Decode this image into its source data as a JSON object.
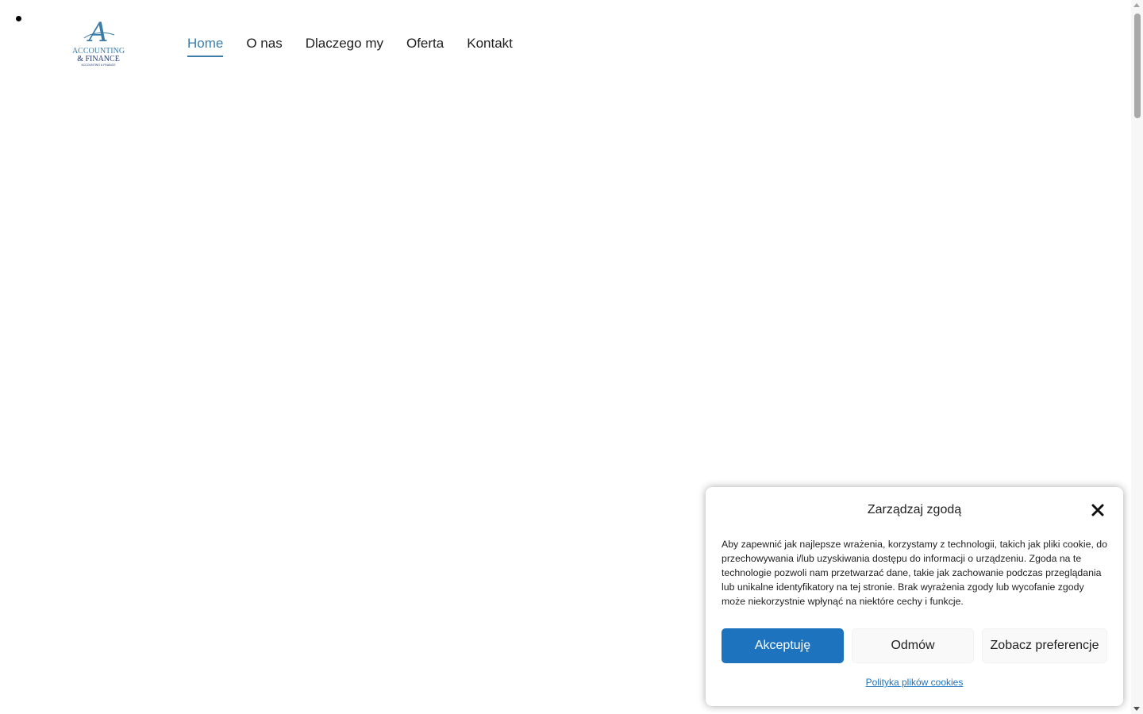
{
  "logo": {
    "monogram": "A",
    "line1": "ACCOUNTING",
    "line2": "& FINANCE",
    "tagline": "ACCOUNTING & FINANCE"
  },
  "nav": {
    "items": [
      {
        "label": "Home",
        "active": true
      },
      {
        "label": "O nas",
        "active": false
      },
      {
        "label": "Dlaczego my",
        "active": false
      },
      {
        "label": "Oferta",
        "active": false
      },
      {
        "label": "Kontakt",
        "active": false
      }
    ]
  },
  "cookie": {
    "title": "Zarządzaj zgodą",
    "text": "Aby zapewnić jak najlepsze wrażenia, korzystamy z technologii, takich jak pliki cookie, do przechowywania i/lub uzyskiwania dostępu do informacji o urządzeniu. Zgoda na te technologie pozwoli nam przetwarzać dane, takie jak zachowanie podczas przeglądania lub unikalne identyfikatory na tej stronie. Brak wyrażenia zgody lub wycofanie zgody może niekorzystnie wpłynąć na niektóre cechy i funkcje.",
    "accept_label": "Akceptuję",
    "deny_label": "Odmów",
    "prefs_label": "Zobacz preferencje",
    "policy_link": "Polityka plików cookies"
  },
  "colors": {
    "accent": "#3b7ca8",
    "button_primary": "#1e73be"
  }
}
